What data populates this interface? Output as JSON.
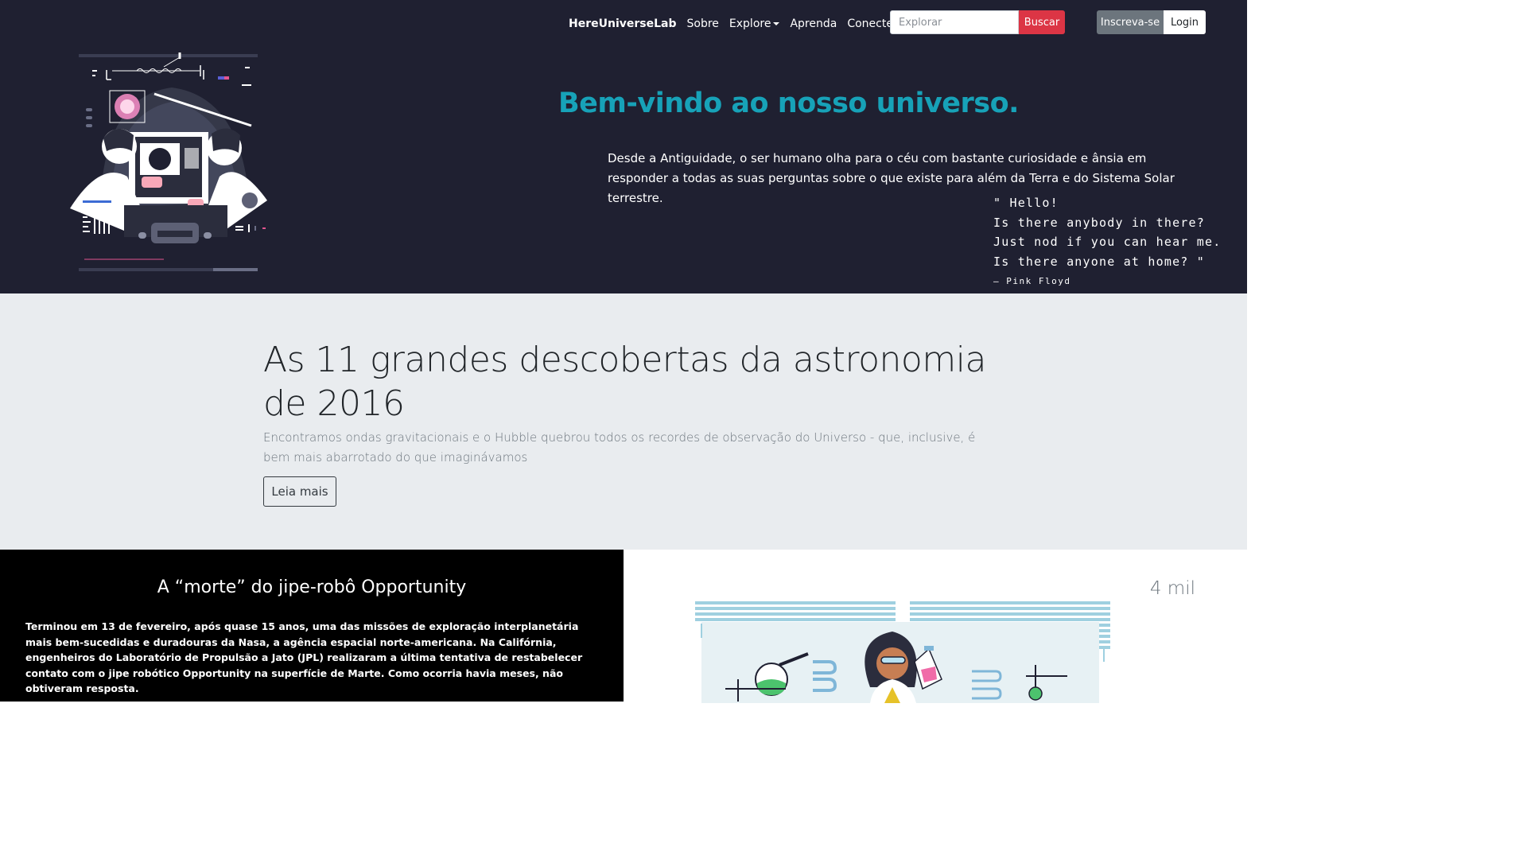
{
  "nav": {
    "brand": "HereUniverseLab",
    "links": [
      "Sobre",
      "Explore",
      "Aprenda",
      "Conecte-se"
    ],
    "search_placeholder": "Explorar",
    "search_button": "Buscar",
    "signup_button": "Inscreva-se",
    "login_button": "Login"
  },
  "hero": {
    "title": "Bem-vindo ao nosso universo.",
    "text": "Desde a Antiguidade, o ser humano olha para o céu com bastante curiosidade e ânsia em responder a todas as suas perguntas sobre o que existe para além da Terra e do Sistema Solar terrestre.",
    "quote_lines": [
      "\" Hello!",
      "Is there anybody in there?",
      "Just nod if you can hear me.",
      "Is there anyone at home? \""
    ],
    "quote_author": "—  Pink Floyd"
  },
  "jumbotron": {
    "title": "As 11 grandes descobertas da astronomia de 2016",
    "text": "Encontramos ondas gravitacionais e o Hubble quebrou todos os recordes de observação do Universo - que, inclusive, é bem mais abarrotado do que imaginávamos",
    "button": "Leia mais"
  },
  "article": {
    "title": "A “morte” do jipe-robô Opportunity",
    "text": "Terminou em 13 de fevereiro, após quase 15 anos, uma das missões de exploração interplanetária mais bem-sucedidas e duradouras da Nasa, a agência espacial norte-americana. Na Califórnia, engenheiros do Laboratório de Propulsão a Jato (JPL) realizaram a última tentativa de restabelecer contato com o jipe robótico Opportunity na superfície de Marte. Como ocorria havia meses, não obtiveram resposta."
  },
  "stat": {
    "value": "4 mil"
  },
  "colors": {
    "hero_bg": "#1f2031",
    "accent": "#17a2b8",
    "danger": "#dc3545",
    "secondary": "#6c757d",
    "jumbo_bg": "#e9ecef"
  },
  "icons": [
    "astronomers-illustration",
    "scientist-lab-illustration",
    "dropdown-caret-icon"
  ]
}
